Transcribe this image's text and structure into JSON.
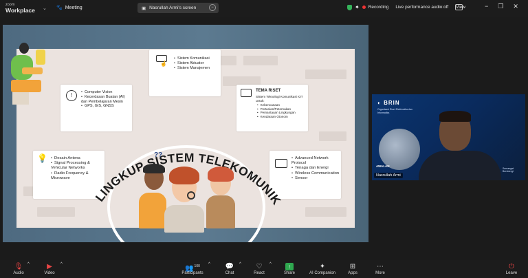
{
  "app": {
    "brand_top": "zoom",
    "brand_name": "Workplace",
    "meeting_label": "Meeting"
  },
  "screen_share": {
    "label": "Nasrullah Armi's screen"
  },
  "status": {
    "recording": "Recording",
    "audio_status": "Live performance audio:off",
    "view_label": "View"
  },
  "slide": {
    "title": "RUANG LINGKUP SISTEM TELEKOMUNIKASI IOT",
    "card_komunikasi": [
      "Sistem Komunikasi",
      "Sistem Aktuator",
      "Sistem Manajemen"
    ],
    "card_vision": [
      "Computer Vision",
      "Kecerdasan Buatan (AI) dan Pembelajaran Mesin",
      "GPS, GIS, GNSS"
    ],
    "card_tema": {
      "heading": "TEMA RISET",
      "intro": "Sistem Teknologi Komunikasi IOT untuk:",
      "items": [
        "Kebencanaan",
        "Pertanian/Peternakan",
        "Pemantauan Lingkungan",
        "Kendaraan Otonom"
      ]
    },
    "card_antena": [
      "Desain Antena",
      "Signal Processing & Vehicular Networks",
      "Radio Frequency & Microwave"
    ],
    "card_network": [
      "Advanced Network Protocol",
      "Tenaga dan Energi",
      "Wireless Communication",
      "Sensor"
    ]
  },
  "video": {
    "participant_name": "Nasrullah Armi",
    "logo_text": "BRIN",
    "logo_sub": "Organisasi Riset Elektronika dan Informatika",
    "tag_left": "AWALAN",
    "logo2": "Semangat Bersinergi"
  },
  "toolbar": {
    "audio": "Audio",
    "video": "Video",
    "participants": "Participants",
    "participants_count": "100",
    "chat": "Chat",
    "react": "React",
    "share": "Share",
    "ai_companion": "AI Companion",
    "apps": "Apps",
    "more": "More",
    "leave": "Leave"
  },
  "colors": {
    "toolbar_bg": "#1c1c1c",
    "share_green": "#2fa84f",
    "alert_red": "#e84545",
    "record_red": "#e33333"
  }
}
